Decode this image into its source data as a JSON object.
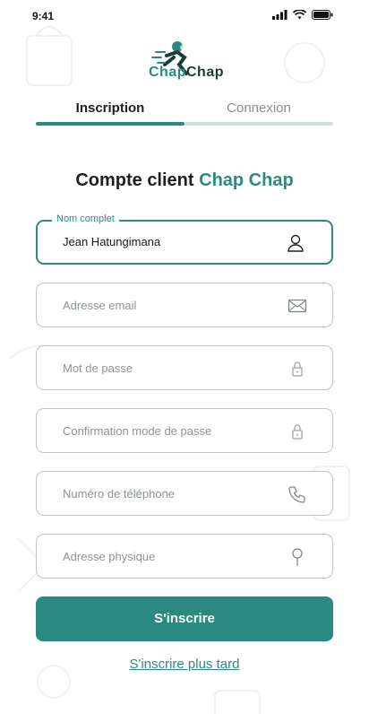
{
  "status_bar": {
    "time": "9:41"
  },
  "logo": {
    "part1": "Chap",
    "part2": "Chap"
  },
  "tabs": [
    {
      "label": "Inscription",
      "active": true
    },
    {
      "label": "Connexion",
      "active": false
    }
  ],
  "heading": {
    "prefix": "Compte client",
    "accent": "Chap Chap"
  },
  "form": {
    "full_name": {
      "label": "Nom complet",
      "value": "Jean Hatungimana",
      "icon": "user-icon"
    },
    "email": {
      "placeholder": "Adresse email",
      "icon": "mail-icon"
    },
    "password": {
      "placeholder": "Mot de passe",
      "icon": "lock-icon"
    },
    "password_confirm": {
      "placeholder": "Confirmation mode de passe",
      "icon": "lock-icon"
    },
    "phone": {
      "placeholder": "Numéro de téléphone",
      "icon": "phone-icon"
    },
    "address": {
      "placeholder": "Adresse physique",
      "icon": "pin-icon"
    }
  },
  "actions": {
    "submit_label": "S'inscrire",
    "later_label": "S'inscrire plus tard"
  },
  "colors": {
    "accent": "#2a8a82",
    "dark": "#1d3b35",
    "border": "#bfc6c5"
  }
}
